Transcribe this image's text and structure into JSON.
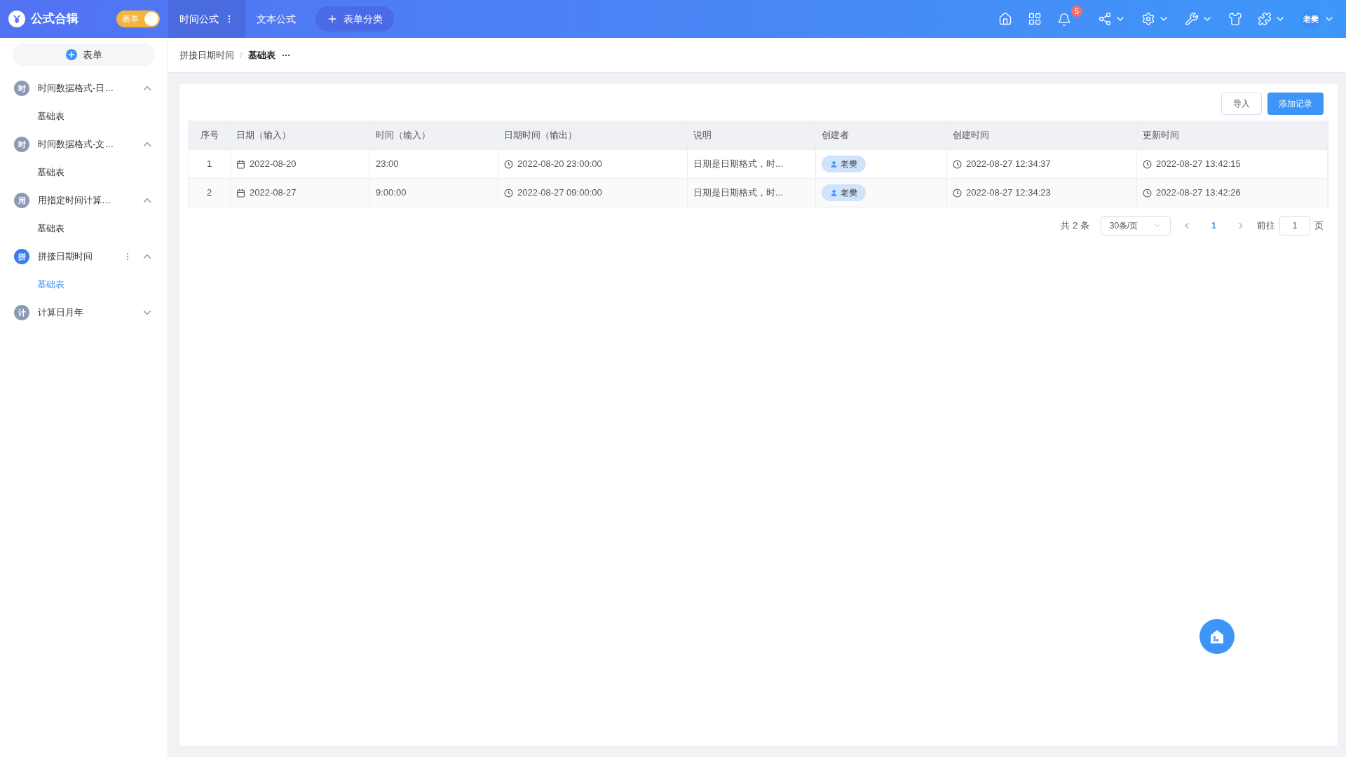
{
  "app": {
    "title": "公式合辑",
    "toggle": {
      "label": "表单",
      "on": true
    }
  },
  "top_tabs": [
    {
      "label": "时间公式",
      "selected": true
    },
    {
      "label": "文本公式",
      "selected": false
    }
  ],
  "add_category": "表单分类",
  "notifications": {
    "badge": "5"
  },
  "user": {
    "name": "老樊"
  },
  "sidebar": {
    "add_button": "表单",
    "groups": [
      {
        "label": "时间数据格式-日…",
        "avatar": "时",
        "active": false,
        "expanded": true,
        "children": [
          {
            "label": "基础表",
            "selected": false
          }
        ]
      },
      {
        "label": "时间数据格式-文…",
        "avatar": "时",
        "active": false,
        "expanded": true,
        "children": [
          {
            "label": "基础表",
            "selected": false
          }
        ]
      },
      {
        "label": "用指定时间计算…",
        "avatar": "用",
        "active": false,
        "expanded": true,
        "children": [
          {
            "label": "基础表",
            "selected": false
          }
        ]
      },
      {
        "label": "拼接日期时间",
        "avatar": "拼",
        "active": true,
        "expanded": true,
        "children": [
          {
            "label": "基础表",
            "selected": true
          }
        ]
      },
      {
        "label": "计算日月年",
        "avatar": "计",
        "active": false,
        "expanded": false
      }
    ]
  },
  "breadcrumb": {
    "items": [
      "拼接日期时间",
      "基础表"
    ],
    "separator": "/"
  },
  "toolbar": {
    "import": "导入",
    "add": "添加记录"
  },
  "table": {
    "columns": [
      "序号",
      "日期（输入）",
      "时间（输入）",
      "日期时间（输出）",
      "说明",
      "创建者",
      "创建时间",
      "更新时间"
    ],
    "rows": [
      {
        "index": "1",
        "date": "2022-08-20",
        "time": "23:00",
        "datetime": "2022-08-20 23:00:00",
        "note": "日期是日期格式，时...",
        "creator": "老樊",
        "created": "2022-08-27 12:34:37",
        "updated": "2022-08-27 13:42:15"
      },
      {
        "index": "2",
        "date": "2022-08-27",
        "time": "9:00:00",
        "datetime": "2022-08-27 09:00:00",
        "note": "日期是日期格式，时...",
        "creator": "老樊",
        "created": "2022-08-27 12:34:23",
        "updated": "2022-08-27 13:42:26"
      }
    ]
  },
  "pagination": {
    "total": "共 2 条",
    "page_size": "30条/页",
    "pages": [
      {
        "label": "1",
        "selected": true
      }
    ],
    "goto_label": "前往",
    "goto_value": "1",
    "goto_suffix": "页"
  }
}
